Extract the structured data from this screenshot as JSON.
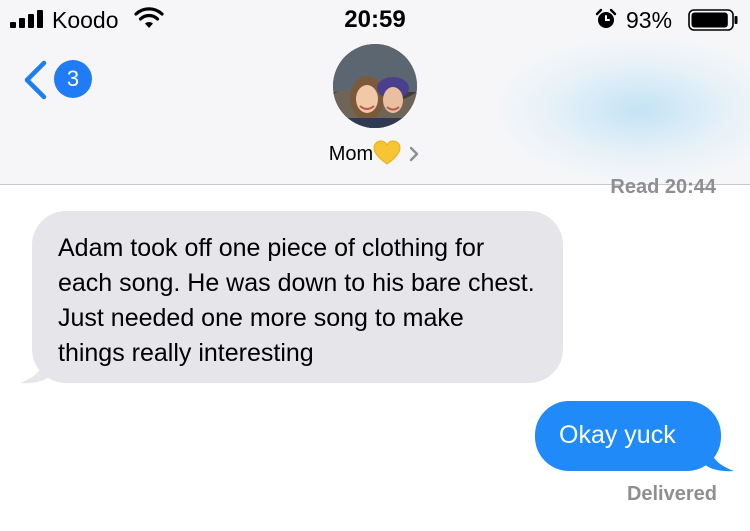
{
  "status_bar": {
    "carrier": "Koodo",
    "time": "20:59",
    "battery_percent": "93%",
    "battery_level": 0.93,
    "icons": [
      "signal-icon",
      "wifi-icon",
      "alarm-icon",
      "battery-icon"
    ]
  },
  "nav": {
    "back_count": "3",
    "contact_name": "Mom",
    "contact_emoji": "yellow-heart-icon"
  },
  "conversation": {
    "read_receipt": "Read 20:44",
    "incoming_message": "Adam took off one piece of clothing for each song. He was down to his bare chest. Just needed one more song to make things really interesting",
    "outgoing_message": "Okay yuck",
    "delivery_status": "Delivered"
  },
  "colors": {
    "accent": "#1f7bf6",
    "outgoing_bubble": "#1f8af8",
    "incoming_bubble": "#e5e5ea",
    "muted_text": "#8e8e93",
    "heart": "#f7c531"
  }
}
